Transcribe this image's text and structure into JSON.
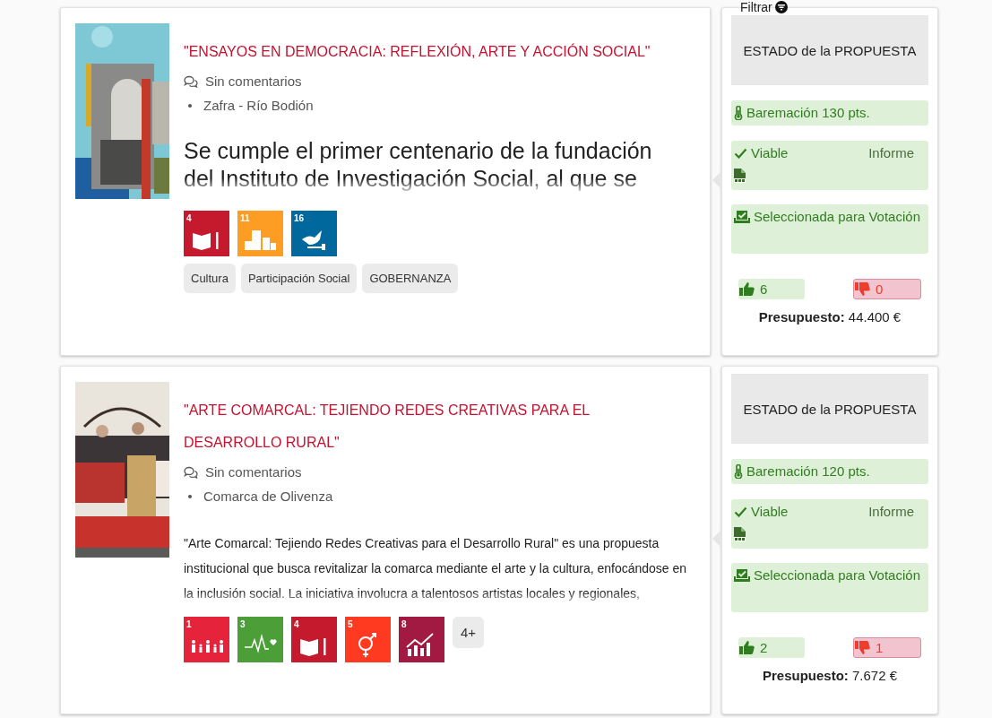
{
  "filter": {
    "label": "Filtrar"
  },
  "proposals": [
    {
      "title": "\"ENSAYOS EN DEMOCRACIA: REFLEXIÓN, ARTE Y ACCIÓN SOCIAL\"",
      "comments": "Sin comentarios",
      "location": "Zafra - Río Bodión",
      "description": {
        "kind": "lead",
        "text": "Se cumple el primer centenario de la fundación del Instituto de Investigación Social, al que se"
      },
      "sdgs": [
        {
          "number": "4",
          "color": "#c5192d"
        },
        {
          "number": "11",
          "color": "#fd9d24"
        },
        {
          "number": "16",
          "color": "#00689d"
        }
      ],
      "tags": [
        "Cultura",
        "Participación Social",
        "GOBERNANZA"
      ],
      "status": {
        "heading": "ESTADO de la PROPUESTA",
        "score": "Baremación 130 pts.",
        "viability": "Viable",
        "report": "Informe",
        "selection": "Seleccionada para Votación",
        "likes": "6",
        "dislikes": "0",
        "budget_label": "Presupuesto:",
        "budget": "44.400 €"
      }
    },
    {
      "title": "\"ARTE COMARCAL: TEJIENDO REDES CREATIVAS PARA EL DESARROLLO RURAL\"",
      "comments": "Sin comentarios",
      "location": "Comarca de Olivenza",
      "description": {
        "kind": "body",
        "text": "\"Arte Comarcal: Tejiendo Redes Creativas para el Desarrollo Rural\" es una propuesta institucional que busca revitalizar la comarca mediante el arte y la cultura, enfocándose en la inclusión social. La iniciativa involucra a talentosos artistas locales y regionales,"
      },
      "sdgs": [
        {
          "number": "1",
          "color": "#e5243b"
        },
        {
          "number": "3",
          "color": "#4c9f38"
        },
        {
          "number": "4",
          "color": "#c5192d"
        },
        {
          "number": "5",
          "color": "#ff3a21"
        },
        {
          "number": "8",
          "color": "#a21942"
        }
      ],
      "more": "4+",
      "status": {
        "heading": "ESTADO de la PROPUESTA",
        "score": "Baremación 120 pts.",
        "viability": "Viable",
        "report": "Informe",
        "selection": "Seleccionada para Votación",
        "likes": "2",
        "dislikes": "1",
        "budget_label": "Presupuesto:",
        "budget": "7.672 €"
      }
    }
  ]
}
